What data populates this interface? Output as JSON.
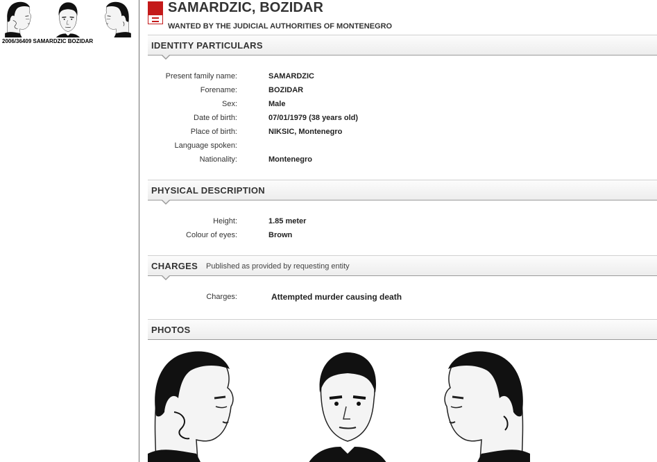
{
  "sidebar": {
    "caption": "2006/36409 SAMARDZIC BOZIDAR"
  },
  "header": {
    "title": "SAMARDZIC, BOZIDAR",
    "subtitle": "WANTED BY THE JUDICIAL AUTHORITIES OF MONTENEGRO",
    "logo_icon": "interpol-red-notice-icon"
  },
  "identity": {
    "heading": "IDENTITY PARTICULARS",
    "rows": [
      {
        "label": "Present family name:",
        "value": "SAMARDZIC"
      },
      {
        "label": "Forename:",
        "value": "BOZIDAR"
      },
      {
        "label": "Sex:",
        "value": "Male"
      },
      {
        "label": "Date of birth:",
        "value": "07/01/1979 (38 years old)"
      },
      {
        "label": "Place of birth:",
        "value": "NIKSIC, Montenegro"
      },
      {
        "label": "Language spoken:",
        "value": ""
      },
      {
        "label": "Nationality:",
        "value": "Montenegro"
      }
    ]
  },
  "physical": {
    "heading": "PHYSICAL DESCRIPTION",
    "rows": [
      {
        "label": "Height:",
        "value": "1.85 meter"
      },
      {
        "label": "Colour of eyes:",
        "value": "Brown"
      }
    ]
  },
  "charges": {
    "heading": "CHARGES",
    "subheading": "Published as provided by requesting entity",
    "label": "Charges:",
    "value": "Attempted murder causing death"
  },
  "photos": {
    "heading": "PHOTOS"
  },
  "colors": {
    "logo_red": "#c41a1a",
    "header_border": "#9a9a9a"
  }
}
